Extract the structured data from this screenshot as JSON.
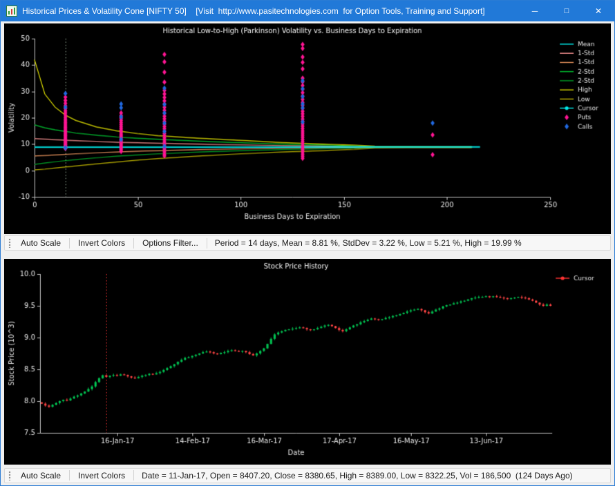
{
  "window": {
    "title": "Historical Prices & Volatility Cone [NIFTY 50]    [Visit  http://www.pasitechnologies.com  for Option Tools, Training and Support]",
    "controls": {
      "minimize": "─",
      "maximize": "□",
      "close": "✕"
    }
  },
  "toolbar_top": {
    "buttons": [
      "Auto Scale",
      "Invert Colors",
      "Options Filter..."
    ],
    "status": "Period = 14 days, Mean = 8.81 %, StdDev = 3.22 %, Low = 5.21 %, High = 19.99 %"
  },
  "toolbar_bottom": {
    "buttons": [
      "Auto Scale",
      "Invert Colors"
    ],
    "status": "Date = 11-Jan-17, Open = 8407.20, Close = 8380.65, High = 8389.00, Low = 8322.25, Vol = 186,500  (124 Days Ago)"
  },
  "chart_data": [
    {
      "type": "scatter",
      "title": "Historical Low-to-High (Parkinson) Volatility vs. Business Days to Expiration",
      "xlabel": "Business Days to Expiration",
      "ylabel": "Volatility",
      "xlim": [
        0,
        250
      ],
      "ylim": [
        -10,
        50
      ],
      "xticks": [
        0,
        50,
        100,
        150,
        200,
        250
      ],
      "yticks": [
        -10,
        0,
        10,
        20,
        30,
        40,
        50
      ],
      "grid": false,
      "legend_position": "right",
      "cursor_x": 15,
      "cursor_y": 8.81,
      "cursor_line_color": "#9fb49f",
      "colors": {
        "puts": "#ff1493",
        "calls": "#2068e0",
        "cursor": "#00e6e6",
        "axis": "#c8c8c8",
        "text": "#e6e6e6",
        "background": "#000000"
      },
      "lines": [
        {
          "name": "High",
          "color": "#e0e000",
          "width": 1.2,
          "x": [
            0,
            5,
            10,
            15,
            20,
            30,
            40,
            50,
            60,
            80,
            100,
            120,
            140,
            155,
            165,
            180,
            200,
            212
          ],
          "y": [
            42,
            29,
            24,
            21,
            19,
            16.5,
            15,
            14,
            13.2,
            12.2,
            11.4,
            10.6,
            10.0,
            9.6,
            9.2,
            9.15,
            9.1,
            9.1
          ]
        },
        {
          "name": "Low",
          "color": "#bdb200",
          "width": 1.2,
          "x": [
            0,
            5,
            10,
            15,
            20,
            30,
            40,
            50,
            60,
            80,
            100,
            120,
            140,
            155,
            165,
            180,
            200,
            212
          ],
          "y": [
            0.2,
            0.5,
            0.9,
            1.3,
            1.7,
            2.5,
            3.2,
            3.9,
            4.5,
            5.5,
            6.3,
            7.0,
            7.5,
            8.0,
            8.55,
            8.6,
            8.6,
            8.6
          ]
        },
        {
          "name": "2-Std-Upper",
          "color": "#00c832",
          "width": 1.2,
          "x": [
            0,
            5,
            10,
            15,
            20,
            30,
            40,
            50,
            60,
            80,
            100,
            120,
            140,
            155,
            165,
            180,
            200,
            212
          ],
          "y": [
            17.3,
            16.2,
            15.4,
            14.8,
            14.2,
            13.4,
            12.7,
            12.2,
            11.8,
            11.1,
            10.5,
            10.0,
            9.6,
            9.3,
            9.05,
            9.0,
            9.0,
            9.0
          ]
        },
        {
          "name": "2-Std-Lower",
          "color": "#00a828",
          "width": 1.2,
          "x": [
            0,
            5,
            10,
            15,
            20,
            30,
            40,
            50,
            60,
            80,
            100,
            120,
            140,
            155,
            165,
            180,
            200,
            212
          ],
          "y": [
            2.3,
            2.8,
            3.3,
            3.7,
            4.1,
            4.8,
            5.4,
            5.9,
            6.3,
            7.0,
            7.5,
            7.9,
            8.2,
            8.45,
            8.7,
            8.72,
            8.72,
            8.72
          ]
        },
        {
          "name": "1-Std-Upper",
          "color": "#f48f8f",
          "width": 1.2,
          "x": [
            0,
            5,
            10,
            15,
            20,
            30,
            40,
            50,
            60,
            80,
            100,
            120,
            140,
            155,
            165,
            180,
            200,
            212
          ],
          "y": [
            12.1,
            11.9,
            11.7,
            11.5,
            11.3,
            11.0,
            10.7,
            10.5,
            10.3,
            10.0,
            9.7,
            9.4,
            9.2,
            9.05,
            8.95,
            8.95,
            8.95,
            8.95
          ]
        },
        {
          "name": "1-Std-Lower",
          "color": "#e8935c",
          "width": 1.2,
          "x": [
            0,
            5,
            10,
            15,
            20,
            30,
            40,
            50,
            60,
            80,
            100,
            120,
            140,
            155,
            165,
            180,
            200,
            212
          ],
          "y": [
            5.5,
            5.7,
            5.9,
            6.1,
            6.3,
            6.7,
            7.0,
            7.3,
            7.5,
            7.9,
            8.2,
            8.45,
            8.6,
            8.7,
            8.8,
            8.82,
            8.82,
            8.82
          ]
        },
        {
          "name": "Mean",
          "color": "#00e6e6",
          "width": 2,
          "x": [
            0,
            40,
            80,
            120,
            160,
            200,
            216
          ],
          "y": [
            8.82,
            8.85,
            8.87,
            8.88,
            8.89,
            8.9,
            8.9
          ]
        }
      ],
      "clusters": [
        {
          "x": 15,
          "puts": [
            8.3,
            8.8,
            9.2,
            9.6,
            10,
            10.4,
            10.8,
            11.2,
            11.6,
            12,
            12.5,
            13,
            13.5,
            14,
            14.5,
            15,
            15.5,
            16,
            16.5,
            17,
            17.6,
            18.2,
            18.8,
            19.5,
            20.2,
            21,
            21.8,
            22.6,
            23.5,
            24.5,
            25.5,
            26.6,
            27.8
          ],
          "calls": [
            29.2,
            24,
            8.6
          ]
        },
        {
          "x": 42,
          "puts": [
            7.2,
            7.8,
            8.3,
            8.8,
            9.3,
            9.8,
            10.3,
            10.8,
            11.4,
            12,
            12.6,
            13.2,
            13.8,
            14.5,
            15.2,
            15.9,
            16.6,
            17.4,
            18.2,
            19,
            19.9,
            20.8,
            21.8
          ],
          "calls": [
            25.2,
            23.8,
            20.3,
            11.8
          ]
        },
        {
          "x": 63,
          "puts": [
            5.5,
            6.2,
            7,
            7.8,
            8.5,
            9.2,
            10,
            10.8,
            11.6,
            12.4,
            13.2,
            14,
            14.9,
            15.8,
            16.7,
            17.6,
            18.6,
            19.6,
            20.6,
            21.7,
            22.8,
            24,
            25.2,
            26.4,
            27.7,
            29,
            30.4,
            33.5,
            37.3,
            41.2,
            44
          ],
          "calls": [
            31.2,
            25,
            21.8,
            18,
            14.8,
            9.2
          ]
        },
        {
          "x": 130,
          "puts": [
            4.6,
            5.4,
            6.2,
            7,
            7.8,
            8.6,
            9.4,
            10.2,
            11,
            11.8,
            12.6,
            13.4,
            14.2,
            15,
            15.9,
            16.8,
            17.7,
            18.6,
            19.5,
            20.5,
            21.5,
            22.5,
            23.6,
            24.7,
            25.8,
            27,
            28.2,
            29.5,
            30.8,
            32.2,
            33.6,
            35,
            38.5,
            41,
            43,
            46.3,
            47.8
          ],
          "calls": [
            34,
            31,
            28,
            25.2,
            23.8,
            18.4
          ]
        },
        {
          "x": 193,
          "puts": [
            13.5,
            6
          ],
          "calls": [
            18
          ]
        }
      ],
      "legend": [
        {
          "label": "Mean",
          "color": "#00e6e6",
          "marker": "line"
        },
        {
          "label": "1-Std",
          "color": "#f48f8f",
          "marker": "line"
        },
        {
          "label": "1-Std",
          "color": "#e8935c",
          "marker": "line"
        },
        {
          "label": "2-Std",
          "color": "#00c832",
          "marker": "line"
        },
        {
          "label": "2-Std",
          "color": "#00a828",
          "marker": "line"
        },
        {
          "label": "High",
          "color": "#e0e000",
          "marker": "line"
        },
        {
          "label": "Low",
          "color": "#bdb200",
          "marker": "line"
        },
        {
          "label": "Cursor",
          "color": "#00e6e6",
          "marker": "line-dot"
        },
        {
          "label": "Puts",
          "color": "#ff1493",
          "marker": "diamond"
        },
        {
          "label": "Calls",
          "color": "#2068e0",
          "marker": "diamond"
        }
      ]
    },
    {
      "type": "candlestick",
      "title": "Stock Price History",
      "xlabel": "Date",
      "ylabel": "Stock Price (10^3)",
      "ylim": [
        7.5,
        10.0
      ],
      "yticks": [
        7.5,
        8.0,
        8.5,
        9.0,
        9.5,
        10.0
      ],
      "xticks": [
        {
          "day": 21,
          "label": "16-Jan-17"
        },
        {
          "day": 42,
          "label": "14-Feb-17"
        },
        {
          "day": 62,
          "label": "16-Mar-17"
        },
        {
          "day": 83,
          "label": "17-Apr-17"
        },
        {
          "day": 103,
          "label": "16-May-17"
        },
        {
          "day": 124,
          "label": "13-Jun-17"
        }
      ],
      "grid": false,
      "cursor_day": 18,
      "cursor_color": "#ff3232",
      "up_color": "#00c050",
      "down_color": "#ff4444",
      "open_first": 7.98,
      "closes": [
        7.96,
        7.93,
        7.91,
        7.94,
        7.97,
        8.0,
        8.02,
        8.01,
        8.04,
        8.07,
        8.09,
        8.12,
        8.15,
        8.19,
        8.23,
        8.3,
        8.36,
        8.407,
        8.381,
        8.4,
        8.41,
        8.4,
        8.42,
        8.41,
        8.39,
        8.37,
        8.36,
        8.38,
        8.4,
        8.41,
        8.43,
        8.42,
        8.44,
        8.46,
        8.49,
        8.52,
        8.55,
        8.58,
        8.62,
        8.65,
        8.68,
        8.69,
        8.71,
        8.73,
        8.75,
        8.77,
        8.78,
        8.77,
        8.75,
        8.74,
        8.76,
        8.77,
        8.79,
        8.8,
        8.79,
        8.78,
        8.79,
        8.77,
        8.74,
        8.72,
        8.75,
        8.79,
        8.83,
        8.9,
        8.98,
        9.05,
        9.08,
        9.1,
        9.12,
        9.13,
        9.14,
        9.15,
        9.16,
        9.15,
        9.13,
        9.12,
        9.13,
        9.15,
        9.17,
        9.19,
        9.2,
        9.18,
        9.15,
        9.12,
        9.1,
        9.13,
        9.16,
        9.19,
        9.21,
        9.24,
        9.26,
        9.28,
        9.3,
        9.29,
        9.28,
        9.29,
        9.31,
        9.32,
        9.34,
        9.35,
        9.37,
        9.39,
        9.41,
        9.43,
        9.44,
        9.45,
        9.43,
        9.4,
        9.38,
        9.41,
        9.44,
        9.46,
        9.49,
        9.51,
        9.52,
        9.54,
        9.55,
        9.57,
        9.58,
        9.6,
        9.62,
        9.63,
        9.64,
        9.64,
        9.65,
        9.64,
        9.65,
        9.64,
        9.63,
        9.62,
        9.61,
        9.62,
        9.63,
        9.64,
        9.63,
        9.62,
        9.6,
        9.58,
        9.55,
        9.52,
        9.5,
        9.52,
        9.5
      ],
      "legend": [
        {
          "label": "Cursor",
          "color": "#ff3232",
          "marker": "line-dot"
        }
      ]
    }
  ]
}
